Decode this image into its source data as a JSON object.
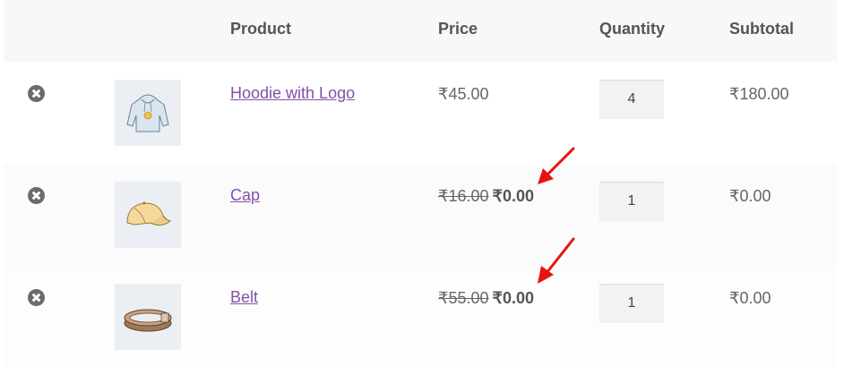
{
  "table": {
    "headers": {
      "product": "Product",
      "price": "Price",
      "quantity": "Quantity",
      "subtotal": "Subtotal"
    },
    "rows": [
      {
        "name": "Hoodie with Logo",
        "price": "₹45.00",
        "regular_price": "",
        "sale_price": "",
        "quantity": "4",
        "subtotal": "₹180.00",
        "thumbnail_icon": "hoodie-icon"
      },
      {
        "name": "Cap",
        "price": "",
        "regular_price": "₹16.00",
        "sale_price": "₹0.00",
        "quantity": "1",
        "subtotal": "₹0.00",
        "thumbnail_icon": "cap-icon"
      },
      {
        "name": "Belt",
        "price": "",
        "regular_price": "₹55.00",
        "sale_price": "₹0.00",
        "quantity": "1",
        "subtotal": "₹0.00",
        "thumbnail_icon": "belt-icon"
      }
    ]
  },
  "colors": {
    "link": "#8350a8",
    "header_bg": "#f8f8f8",
    "thumb_bg": "#ebeff3",
    "annotation_arrow": "#e8130f"
  }
}
